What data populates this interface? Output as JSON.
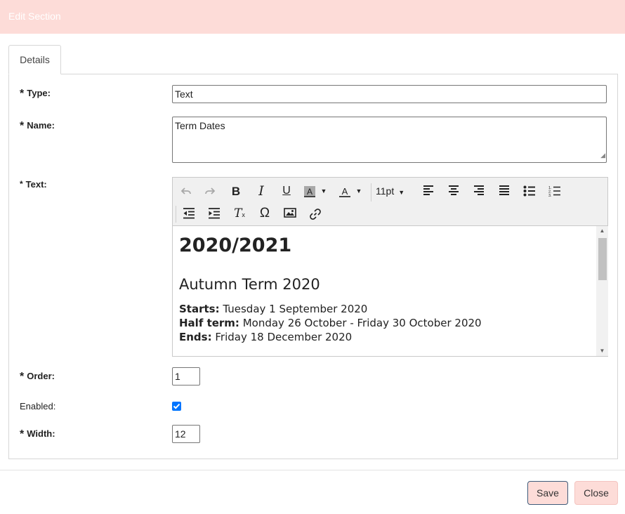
{
  "dialog": {
    "title": "Edit Section"
  },
  "tabs": [
    {
      "label": "Details"
    }
  ],
  "form": {
    "type_label": "Type:",
    "type_value": "Text",
    "name_label": "Name:",
    "name_value": "Term Dates",
    "text_label": "Text:",
    "order_label": "Order:",
    "order_value": "1",
    "enabled_label": "Enabled:",
    "enabled_checked": true,
    "width_label": "Width:",
    "width_value": "12",
    "required_marker": "*"
  },
  "editor": {
    "font_size": "11pt",
    "toolbar_icons": [
      "undo-icon",
      "redo-icon",
      "bold-icon",
      "italic-icon",
      "underline-icon",
      "background-color-icon",
      "text-color-icon",
      "align-left-icon",
      "align-center-icon",
      "align-right-icon",
      "align-justify-icon",
      "bullet-list-icon",
      "numbered-list-icon",
      "outdent-icon",
      "indent-icon",
      "clear-formatting-icon",
      "special-character-icon",
      "image-icon",
      "link-icon"
    ],
    "content": {
      "heading": "2020/2021",
      "subheading": "Autumn Term 2020",
      "lines": [
        {
          "label": "Starts:",
          "text": " Tuesday 1 September 2020"
        },
        {
          "label": "Half term:",
          "text": " Monday 26 October - Friday 30 October 2020"
        },
        {
          "label": "Ends:",
          "text": " Friday 18 December 2020"
        }
      ]
    }
  },
  "buttons": {
    "save": "Save",
    "close": "Close"
  },
  "colors": {
    "header_bg": "#fddcd8",
    "button_bg": "#fddcd8",
    "checkbox": "#0075ff"
  }
}
